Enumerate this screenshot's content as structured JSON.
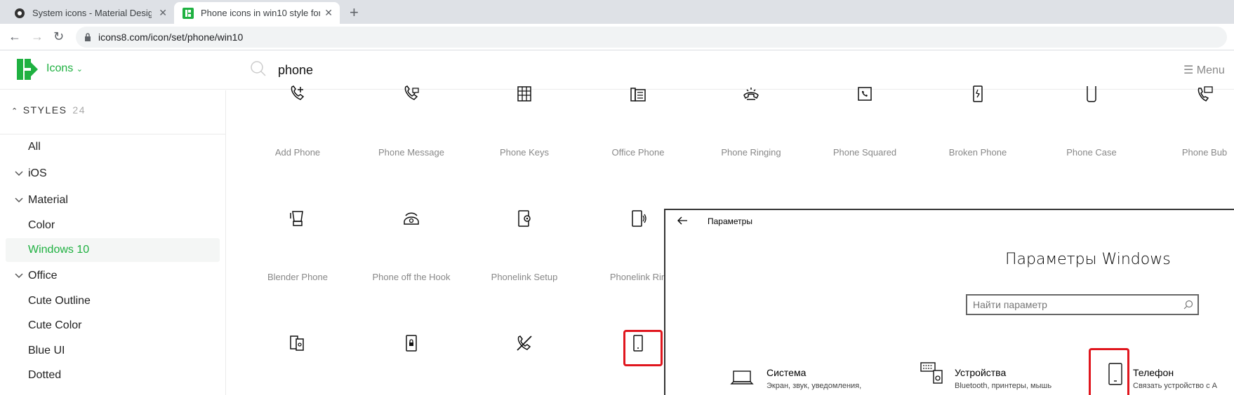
{
  "browser": {
    "tabs": [
      {
        "title": "System icons - Material Design"
      },
      {
        "title": "Phone icons in win10 style for gr"
      }
    ],
    "url": "icons8.com/icon/set/phone/win10"
  },
  "header": {
    "brand": "Icons",
    "search_value": "phone",
    "menu_label": "Menu"
  },
  "sidebar": {
    "styles_label": "STYLES",
    "styles_count": "24",
    "items": [
      {
        "label": "All"
      },
      {
        "label": "iOS"
      },
      {
        "label": "Material"
      },
      {
        "label": "Color"
      },
      {
        "label": "Windows 10"
      },
      {
        "label": "Office"
      },
      {
        "label": "Cute Outline"
      },
      {
        "label": "Cute Color"
      },
      {
        "label": "Blue UI"
      },
      {
        "label": "Dotted"
      }
    ]
  },
  "grid": {
    "row1": [
      "Add Phone",
      "Phone Message",
      "Phone Keys",
      "Office Phone",
      "Phone Ringing",
      "Phone Squared",
      "Broken Phone",
      "Phone Case",
      "Phone Bub"
    ],
    "row2": [
      "Blender Phone",
      "Phone off the Hook",
      "Phonelink Setup",
      "Phonelink Rin"
    ]
  },
  "settings_window": {
    "title": "Параметры",
    "heading": "Параметры Windows",
    "search_placeholder": "Найти параметр",
    "tiles": [
      {
        "name": "Система",
        "desc": "Экран, звук, уведомления,"
      },
      {
        "name": "Устройства",
        "desc": "Bluetooth, принтеры, мышь"
      },
      {
        "name": "Телефон",
        "desc": "Связать устройство с A"
      }
    ]
  },
  "colors": {
    "accent": "#1fb141",
    "highlight": "#e0161e"
  }
}
